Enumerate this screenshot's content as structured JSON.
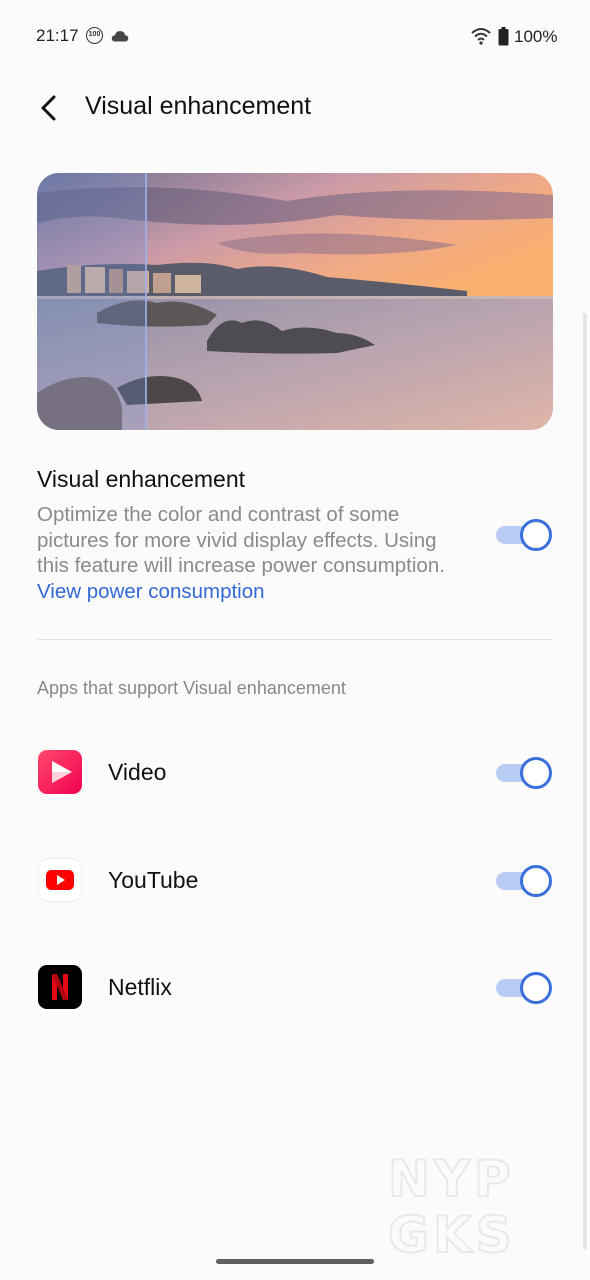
{
  "status_bar": {
    "time": "21:17",
    "badge": "100",
    "battery": "100%",
    "icons": [
      "notification-100-icon",
      "cloud-icon",
      "wifi-icon",
      "battery-icon"
    ]
  },
  "header": {
    "title": "Visual enhancement"
  },
  "main_setting": {
    "title": "Visual enhancement",
    "description": "Optimize the color and contrast of some pictures for more vivid display effects. Using this feature will increase power consumption.",
    "link": "View power consumption",
    "enabled": true
  },
  "apps_section": {
    "label": "Apps that support Visual enhancement",
    "apps": [
      {
        "name": "Video",
        "enabled": true,
        "icon": "video-app-icon"
      },
      {
        "name": "YouTube",
        "enabled": true,
        "icon": "youtube-icon"
      },
      {
        "name": "Netflix",
        "enabled": true,
        "icon": "netflix-icon"
      }
    ]
  },
  "watermark": "NYPGKS",
  "colors": {
    "accent": "#3a6fdc",
    "link": "#3369d6",
    "toggle_track": "#b9ccf3",
    "background": "#fbfbfb"
  }
}
